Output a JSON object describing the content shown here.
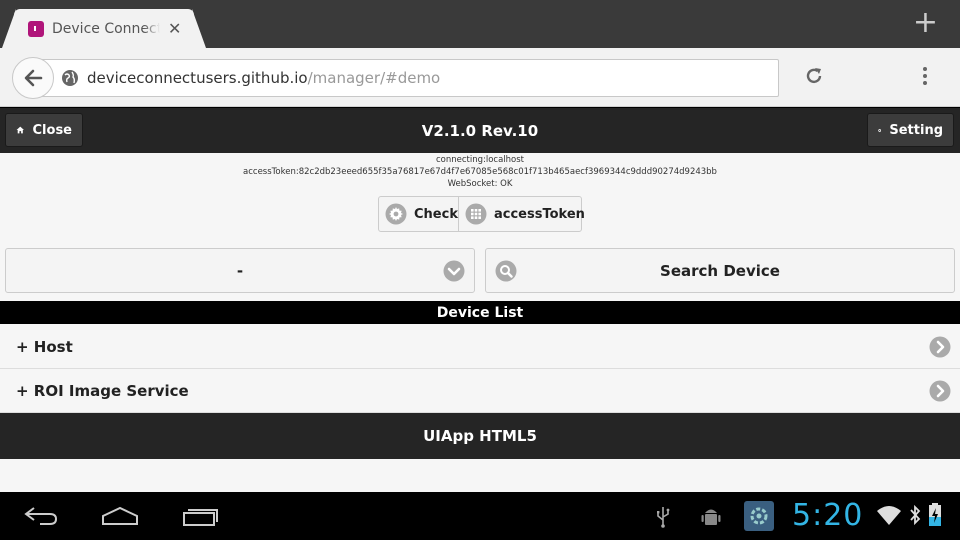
{
  "browser": {
    "tab_title": "Device Connect UI",
    "url_host": "deviceconnectusers.github.io",
    "url_path": "/manager/#demo"
  },
  "header": {
    "close_label": "Close",
    "title": "V2.1.0 Rev.10",
    "setting_label": "Setting"
  },
  "info": {
    "connecting": "connecting:localhost",
    "access_token": "accessToken:82c2db23eeed655f35a76817e67d4f7e67085e568c01f713b465aecf3969344c9ddd90274d9243bb",
    "websocket": "WebSocket: OK"
  },
  "actions": {
    "check_label": "Check",
    "access_token_label": "accessToken"
  },
  "device_select": {
    "selected": "-"
  },
  "search": {
    "label": "Search Device"
  },
  "device_list": {
    "title": "Device List",
    "items": [
      {
        "label": "+ Host"
      },
      {
        "label": "+ ROI Image Service"
      }
    ]
  },
  "footer": {
    "title": "UIApp HTML5"
  },
  "system": {
    "clock": "5:20"
  },
  "colors": {
    "clock": "#33b5e5",
    "favicon": "#b0157a",
    "header_bg": "#252525"
  }
}
